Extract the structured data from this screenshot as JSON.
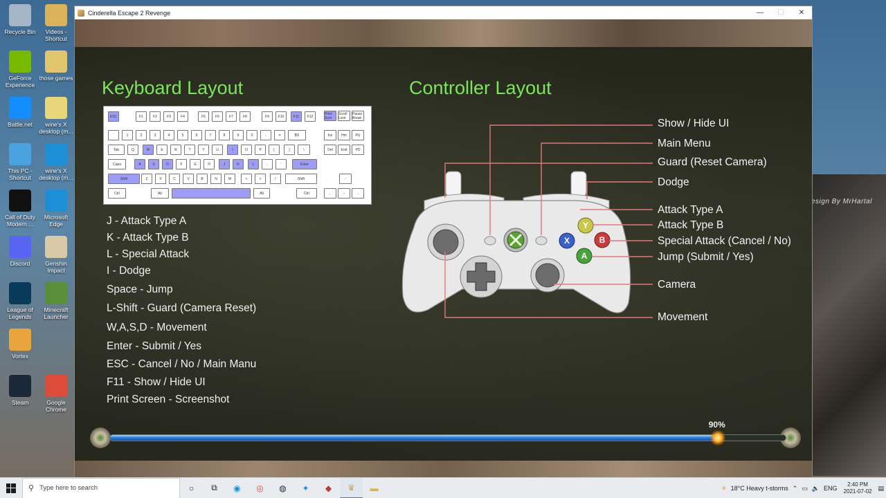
{
  "desktop_icons": [
    {
      "label": "Recycle Bin",
      "icon": "recycle-bin-icon",
      "color": "#a7b6c6"
    },
    {
      "label": "Videos - Shortcut",
      "icon": "folder-icon",
      "color": "#d9b25a"
    },
    {
      "label": "GeForce Experience",
      "icon": "nvidia-icon",
      "color": "#76b900"
    },
    {
      "label": "those games",
      "icon": "folder-icon",
      "color": "#e2c56f"
    },
    {
      "label": "Battle.net",
      "icon": "battlenet-icon",
      "color": "#148eff"
    },
    {
      "label": "wine's X desktop (m...",
      "icon": "folder-icon",
      "color": "#e9d57a"
    },
    {
      "label": "This PC - Shortcut",
      "icon": "computer-icon",
      "color": "#4aa3df"
    },
    {
      "label": "wine's X desktop (m...",
      "icon": "edge-icon",
      "color": "#1d8fd8"
    },
    {
      "label": "Call of Duty Modern ...",
      "icon": "cod-icon",
      "color": "#111111"
    },
    {
      "label": "Microsoft Edge",
      "icon": "edge-icon",
      "color": "#1d8fd8"
    },
    {
      "label": "Discord",
      "icon": "discord-icon",
      "color": "#5865f2"
    },
    {
      "label": "Genshin Impact",
      "icon": "genshin-icon",
      "color": "#d9c9a8"
    },
    {
      "label": "League of Legends",
      "icon": "league-icon",
      "color": "#0a3a5a"
    },
    {
      "label": "Minecraft Launcher",
      "icon": "minecraft-icon",
      "color": "#5a8f3a"
    },
    {
      "label": "Vortex",
      "icon": "vortex-icon",
      "color": "#e8a53c"
    },
    {
      "label": "Steam",
      "icon": "steam-icon",
      "color": "#1b2838"
    },
    {
      "label": "Google Chrome",
      "icon": "chrome-icon",
      "color": "#dd4b39"
    }
  ],
  "background_window": {
    "text": "esign By MrHartal"
  },
  "window": {
    "title": "Cinderella Escape 2 Revenge",
    "minimize": "—",
    "maximize": "☐",
    "close": "✕"
  },
  "keyboard": {
    "heading": "Keyboard Layout",
    "rows": [
      [
        {
          "l": "ESC",
          "hl": true
        },
        {
          "l": "F1"
        },
        {
          "l": "F2"
        },
        {
          "l": "F3"
        },
        {
          "l": "F4"
        },
        {
          "l": "F5"
        },
        {
          "l": "F6"
        },
        {
          "l": "F7"
        },
        {
          "l": "F8"
        },
        {
          "l": "F9"
        },
        {
          "l": "F10"
        },
        {
          "l": "F11",
          "hl": true
        },
        {
          "l": "F12"
        },
        {
          "l": "Print Scrn",
          "hl": true
        },
        {
          "l": "Scroll Lock"
        },
        {
          "l": "Pause Break"
        }
      ],
      [
        {
          "l": "`"
        },
        {
          "l": "1"
        },
        {
          "l": "2"
        },
        {
          "l": "3"
        },
        {
          "l": "4"
        },
        {
          "l": "5"
        },
        {
          "l": "6"
        },
        {
          "l": "7"
        },
        {
          "l": "8"
        },
        {
          "l": "9"
        },
        {
          "l": "0"
        },
        {
          "l": "-"
        },
        {
          "l": "="
        },
        {
          "l": "BS"
        },
        {
          "l": "Ins"
        },
        {
          "l": "Hm"
        },
        {
          "l": "PU"
        }
      ],
      [
        {
          "l": "Tab"
        },
        {
          "l": "Q"
        },
        {
          "l": "W",
          "hl": true
        },
        {
          "l": "E"
        },
        {
          "l": "R"
        },
        {
          "l": "T"
        },
        {
          "l": "Y"
        },
        {
          "l": "U"
        },
        {
          "l": "I",
          "hl": true
        },
        {
          "l": "O"
        },
        {
          "l": "P"
        },
        {
          "l": "["
        },
        {
          "l": "]"
        },
        {
          "l": "\\"
        },
        {
          "l": "Del"
        },
        {
          "l": "End"
        },
        {
          "l": "PD"
        }
      ],
      [
        {
          "l": "Caps"
        },
        {
          "l": "A",
          "hl": true
        },
        {
          "l": "S",
          "hl": true
        },
        {
          "l": "D",
          "hl": true
        },
        {
          "l": "F"
        },
        {
          "l": "G"
        },
        {
          "l": "H"
        },
        {
          "l": "J",
          "hl": true
        },
        {
          "l": "K",
          "hl": true
        },
        {
          "l": "L",
          "hl": true
        },
        {
          "l": ";"
        },
        {
          "l": "'"
        },
        {
          "l": "Enter",
          "hl": true
        }
      ],
      [
        {
          "l": "Shift",
          "hl": true
        },
        {
          "l": "Z"
        },
        {
          "l": "X"
        },
        {
          "l": "C"
        },
        {
          "l": "V"
        },
        {
          "l": "B"
        },
        {
          "l": "N"
        },
        {
          "l": "M"
        },
        {
          "l": "<"
        },
        {
          "l": ">"
        },
        {
          "l": "/"
        },
        {
          "l": "Shift"
        },
        {
          "l": "↑"
        }
      ],
      [
        {
          "l": "Ctrl"
        },
        {
          "l": "Alt"
        },
        {
          "l": "",
          "hl": true
        },
        {
          "l": "Alt"
        },
        {
          "l": "Ctrl"
        },
        {
          "l": "←"
        },
        {
          "l": "↓"
        },
        {
          "l": "→"
        }
      ]
    ],
    "bindings": [
      "J - Attack Type A",
      "K - Attack Type B",
      "L - Special Attack",
      "I - Dodge",
      "Space - Jump",
      "L-Shift - Guard (Camera Reset)",
      "W,A,S,D - Movement",
      "Enter - Submit / Yes",
      "ESC - Cancel / No / Main Manu",
      "F11 - Show / Hide UI",
      "Print Screen - Screenshot"
    ]
  },
  "controller": {
    "heading": "Controller Layout",
    "labels": [
      "Show / Hide UI",
      "Main Menu",
      "Guard (Reset Camera)",
      "Dodge",
      "Attack Type A",
      "Attack Type B",
      "Special Attack (Cancel / No)",
      "Jump (Submit / Yes)",
      "Camera",
      "Movement"
    ],
    "buttons": {
      "y": "Y",
      "b": "B",
      "x": "X",
      "a": "A"
    },
    "callout_color": "#e2777a"
  },
  "loading": {
    "percent_label": "90%",
    "progress": 0.9
  },
  "taskbar": {
    "search_placeholder": "Type here to search",
    "weather": "18°C  Heavy t-storms",
    "language": "ENG",
    "time": "2:40 PM",
    "date": "2021-07-02"
  }
}
